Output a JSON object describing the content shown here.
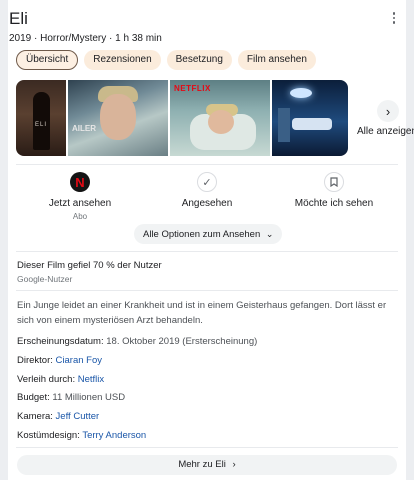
{
  "movie": {
    "title": "Eli",
    "subtitle": "2019 · Horror/Mystery · 1 h 38 min"
  },
  "tabs": [
    {
      "label": "Übersicht",
      "active": true
    },
    {
      "label": "Rezensionen",
      "active": false
    },
    {
      "label": "Besetzung",
      "active": false
    },
    {
      "label": "Film ansehen",
      "active": false
    }
  ],
  "images": {
    "poster_text": "ELI",
    "thumb2_text": "AILER",
    "thumb3_brand": "NETFLIX",
    "more_images_label": "Alle anzeigen"
  },
  "actions": {
    "watch_now": "Jetzt ansehen",
    "watch_now_sub": "Abo",
    "watched": "Angesehen",
    "want_to_see": "Möchte ich sehen",
    "provider_letter": "N",
    "all_options": "Alle Optionen zum Ansehen"
  },
  "rating": {
    "text": "Dieser Film gefiel 70 % der Nutzer",
    "source": "Google-Nutzer"
  },
  "description": "Ein Junge leidet an einer Krankheit und ist in einem Geisterhaus gefangen. Dort lässt er sich von einem mysteriösen Arzt behandeln.",
  "facts": {
    "release_label": "Erscheinungsdatum:",
    "release_value": "18. Oktober 2019 (Ersterscheinung)",
    "director_label": "Direktor:",
    "director_value": "Ciaran Foy",
    "distributor_label": "Verleih durch:",
    "distributor_value": "Netflix",
    "budget_label": "Budget:",
    "budget_value": "11 Millionen USD",
    "camera_label": "Kamera:",
    "camera_value": "Jeff Cutter",
    "costume_label": "Kostümdesign:",
    "costume_value": "Terry Anderson"
  },
  "footer": {
    "more_label": "Mehr zu Eli"
  },
  "icons": {
    "more": "more-vert-icon",
    "arrow": "chevron-right-icon",
    "watched": "check-icon",
    "bookmark": "bookmark-icon",
    "options_arrow": "chevron-down-icon"
  },
  "colors": {
    "link": "#1a56a8",
    "chip": "#fbecdc",
    "netflix_red": "#e50914"
  }
}
